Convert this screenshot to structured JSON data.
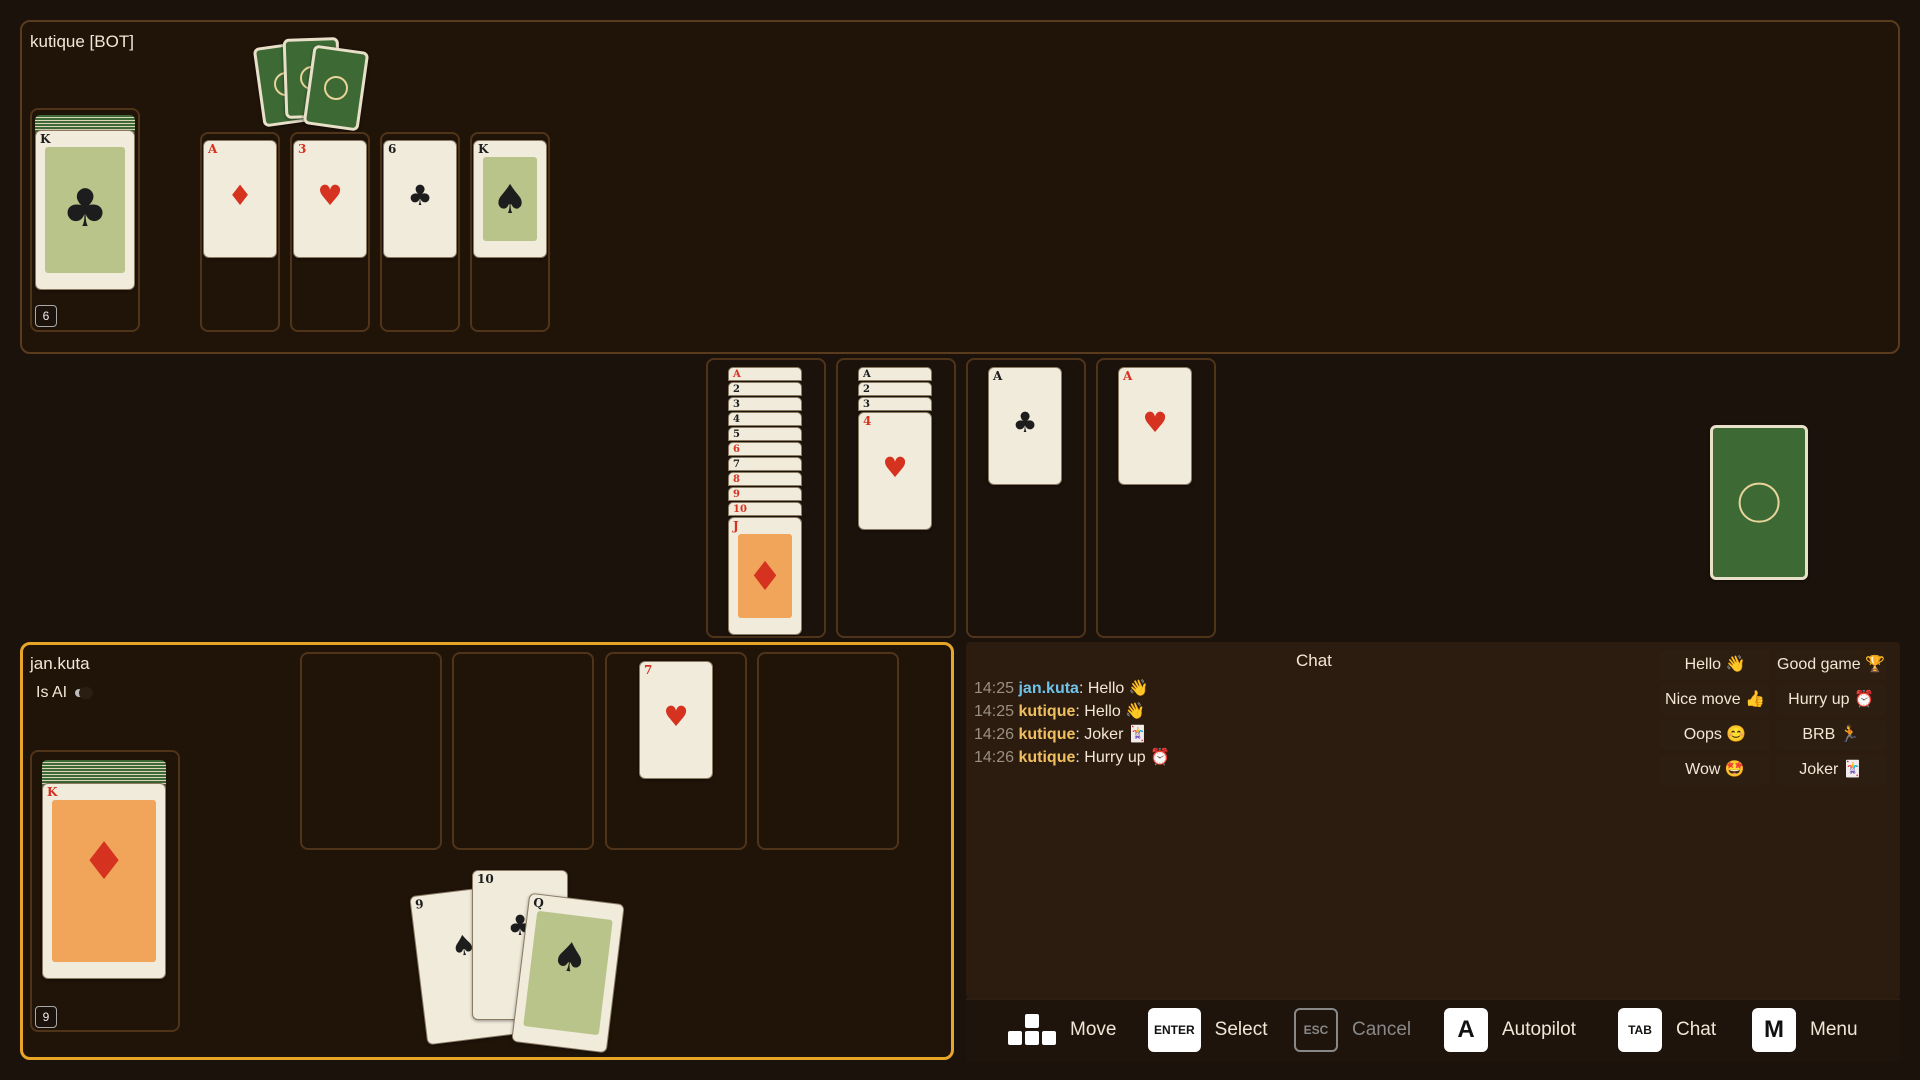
{
  "opponent": {
    "name": "kutique [BOT]",
    "deck_count": "6",
    "deck_top": {
      "rank": "K",
      "suit": "♣",
      "color": "black"
    },
    "foundation": [
      {
        "rank": "A",
        "suit": "♦",
        "color": "red"
      },
      {
        "rank": "3",
        "suit": "♥",
        "color": "red"
      },
      {
        "rank": "6",
        "suit": "♣",
        "color": "black"
      },
      {
        "rank": "K",
        "suit": "♠",
        "color": "black"
      }
    ]
  },
  "center": {
    "piles": [
      {
        "strips": [
          "A",
          "2",
          "3",
          "4",
          "5",
          "6",
          "7",
          "8",
          "9",
          "10"
        ],
        "strip_colors": [
          "red",
          "black",
          "black",
          "black",
          "black",
          "red",
          "black",
          "red",
          "red",
          "red"
        ],
        "top": {
          "rank": "J",
          "suit": "♦",
          "color": "red"
        }
      },
      {
        "strips": [
          "A",
          "2",
          "3"
        ],
        "strip_colors": [
          "black",
          "black",
          "black"
        ],
        "top": {
          "rank": "4",
          "suit": "♥",
          "color": "red"
        }
      },
      {
        "strips": [],
        "strip_colors": [],
        "top": {
          "rank": "A",
          "suit": "♣",
          "color": "black"
        }
      },
      {
        "strips": [],
        "strip_colors": [],
        "top": {
          "rank": "A",
          "suit": "♥",
          "color": "red"
        }
      }
    ]
  },
  "player": {
    "name": "jan.kuta",
    "is_ai_label": "Is AI",
    "deck_count": "9",
    "deck_top": {
      "rank": "K",
      "suit": "♦",
      "color": "red"
    },
    "discard": [
      null,
      null,
      {
        "rank": "7",
        "suit": "♥",
        "color": "red"
      },
      null
    ],
    "hand": [
      {
        "rank": "9",
        "suit": "♠",
        "color": "black"
      },
      {
        "rank": "10",
        "suit": "♣",
        "color": "black"
      },
      {
        "rank": "Q",
        "suit": "♠",
        "color": "black"
      }
    ]
  },
  "chat": {
    "title": "Chat",
    "messages": [
      {
        "time": "14:25",
        "user": "jan.kuta",
        "text": ": Hello 👋",
        "user_color": "#6fc3ea"
      },
      {
        "time": "14:25",
        "user": "kutique",
        "text": ": Hello 👋",
        "user_color": "#f0c060"
      },
      {
        "time": "14:26",
        "user": "kutique",
        "text": ": Joker 🃏",
        "user_color": "#f0c060"
      },
      {
        "time": "14:26",
        "user": "kutique",
        "text": ": Hurry up ⏰",
        "user_color": "#f0c060"
      }
    ],
    "quick": [
      "Hello 👋",
      "Good game 🏆",
      "Nice move 👍",
      "Hurry up ⏰",
      "Oops 😊",
      "BRB 🏃",
      "Wow 🤩",
      "Joker 🃏"
    ]
  },
  "controls": [
    {
      "key": "",
      "label": "Move",
      "icon": "arrow-keys-icon"
    },
    {
      "key": "ENTER",
      "label": "Select",
      "icon": "enter-key-icon"
    },
    {
      "key": "ESC",
      "label": "Cancel",
      "icon": "esc-key-icon"
    },
    {
      "key": "A",
      "label": "Autopilot",
      "icon": "a-key-icon"
    },
    {
      "key": "TAB",
      "label": "Chat",
      "icon": "tab-key-icon"
    },
    {
      "key": "M",
      "label": "Menu",
      "icon": "m-key-icon"
    }
  ],
  "colors": {
    "accent": "#e8a628",
    "panel_border": "#5a3b1e",
    "card_back": "#3d6a34"
  }
}
